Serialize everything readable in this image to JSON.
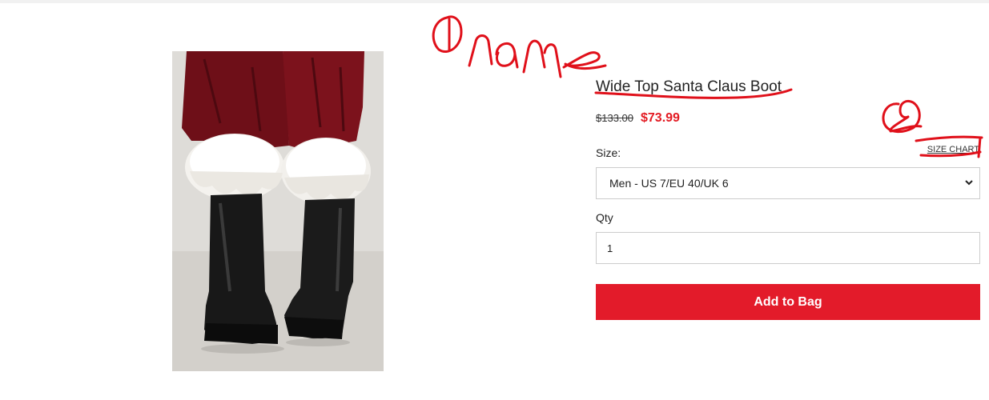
{
  "product": {
    "title": "Wide Top Santa Claus Boot",
    "image_alt": "Santa Claus boots with white fur cuffs"
  },
  "price": {
    "original": "$133.00",
    "sale": "$73.99"
  },
  "size": {
    "label": "Size:",
    "chart_link": "SIZE CHART",
    "selected": "Men - US 7/EU 40/UK 6"
  },
  "qty": {
    "label": "Qty",
    "value": "1"
  },
  "actions": {
    "add_to_bag": "Add to Bag"
  },
  "colors": {
    "accent": "#e31b2a",
    "sale_price": "#e31b23",
    "annotation": "#e0101a"
  }
}
